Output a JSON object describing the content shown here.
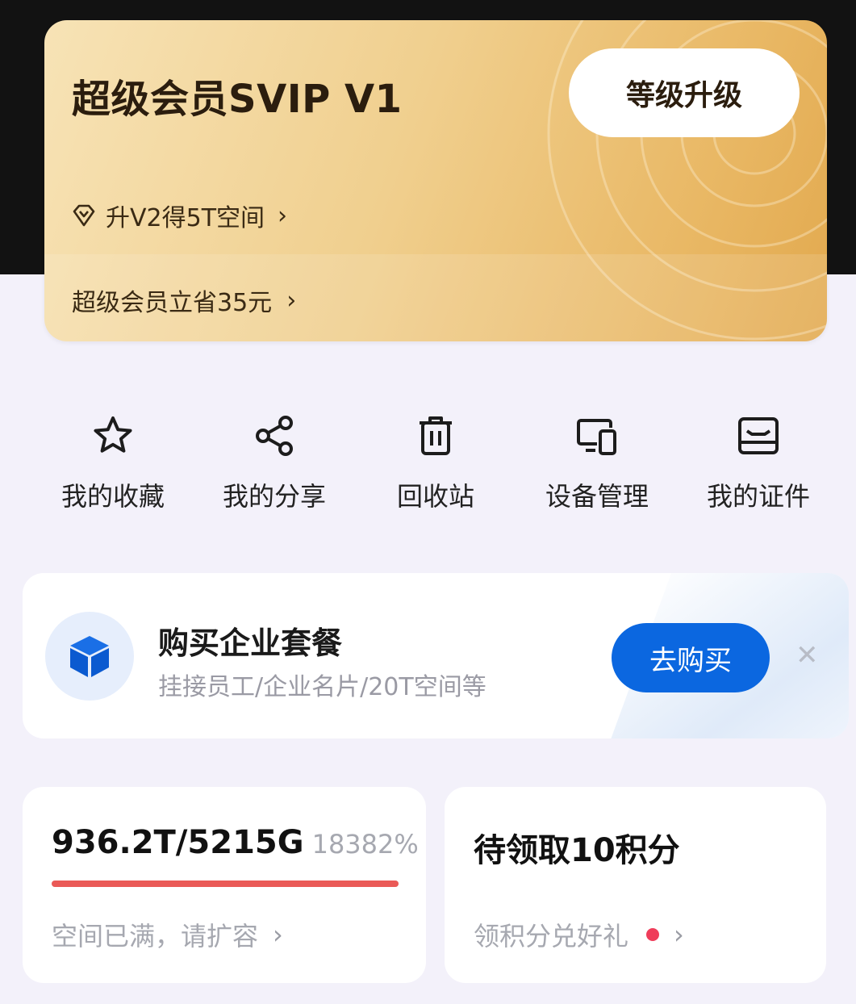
{
  "vip": {
    "title": "超级会员SVIP V1",
    "upgrade_label": "等级升级",
    "promo_text": "升V2得5T空间",
    "save_text": "超级会员立省35元"
  },
  "shortcuts": [
    {
      "label": "我的收藏",
      "icon": "star-icon"
    },
    {
      "label": "我的分享",
      "icon": "share-icon"
    },
    {
      "label": "回收站",
      "icon": "trash-icon"
    },
    {
      "label": "设备管理",
      "icon": "devices-icon"
    },
    {
      "label": "我的证件",
      "icon": "id-card-icon"
    }
  ],
  "business": {
    "title": "购买企业套餐",
    "subtitle": "挂接员工/企业名片/20T空间等",
    "buy_label": "去购买",
    "close_glyph": "✕",
    "icon": "cube-icon",
    "accent": "#0b67e0"
  },
  "storage": {
    "amount": "936.2T/5215G",
    "percent": "18382%",
    "usage_fraction": 1.0,
    "bar_color": "#ea5a57",
    "link_text": "空间已满，请扩容"
  },
  "points": {
    "title": "待领取10积分",
    "link_text": "领积分兑好礼",
    "dot_color": "#ef3d5a"
  },
  "chevron": "›"
}
